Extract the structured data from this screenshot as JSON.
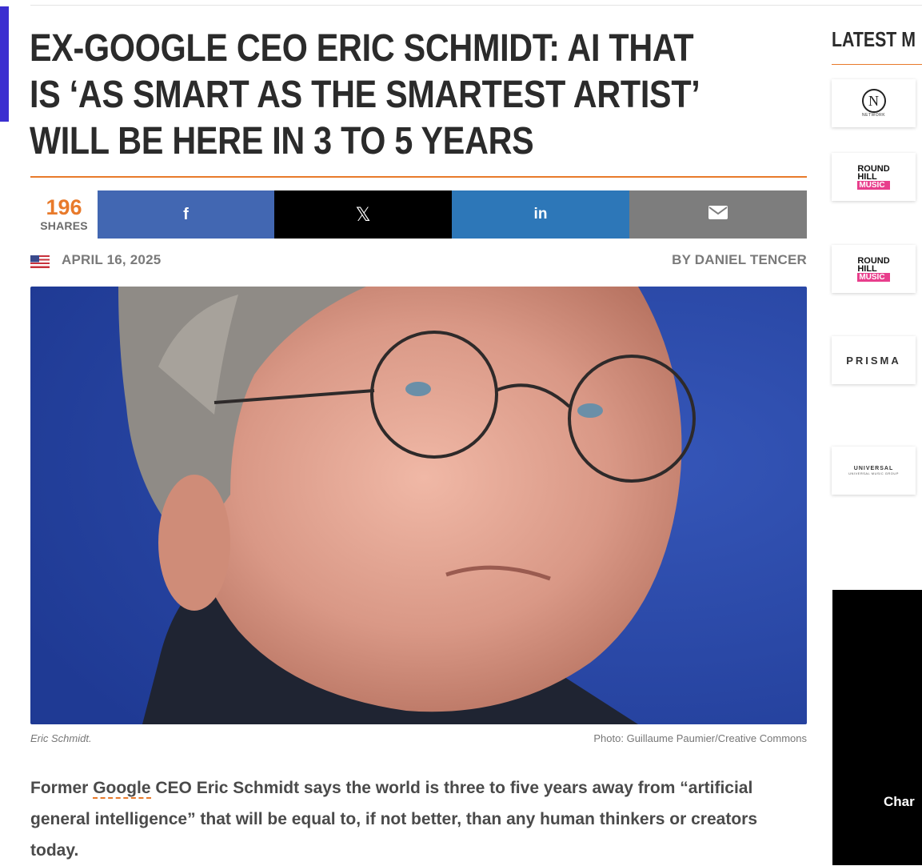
{
  "article": {
    "headline": "EX-GOOGLE CEO ERIC SCHMIDT: AI THAT IS ‘AS SMART AS THE SMARTEST ARTIST’ WILL BE HERE IN 3 TO 5 YEARS",
    "shares": {
      "count": "196",
      "label": "SHARES"
    },
    "share_buttons": [
      {
        "network": "facebook",
        "glyph": "f",
        "icon": "facebook-icon",
        "color": "#4267b2"
      },
      {
        "network": "x",
        "glyph": "𝕏",
        "icon": "x-icon",
        "color": "#000000"
      },
      {
        "network": "linkedin",
        "glyph": "in",
        "icon": "linkedin-icon",
        "color": "#2d77b8"
      },
      {
        "network": "email",
        "glyph": "",
        "icon": "envelope-icon",
        "color": "#7d7d7d"
      }
    ],
    "date": "APRIL 16, 2025",
    "byline": "BY DANIEL TENCER",
    "photo_caption": "Eric Schmidt.",
    "photo_credit": "Photo: Guillaume Paumier/Creative Commons",
    "lead": {
      "before_link": "Former ",
      "link_text": "Google",
      "after_link": " CEO Eric Schmidt says the world is three to five years away from “artificial general intelligence” that will be equal to, if not better, than any human thinkers or creators today."
    }
  },
  "sidebar": {
    "title": "LATEST M",
    "logos": [
      {
        "name": "N NETWORK",
        "text": "N",
        "sub": "NETWORK"
      },
      {
        "name": "ROUND HILL MUSIC",
        "line1": "ROUND",
        "line2": "HILL",
        "line3": "MUSIC"
      },
      {
        "name": "ROUND HILL MUSIC",
        "line1": "ROUND",
        "line2": "HILL",
        "line3": "MUSIC"
      },
      {
        "name": "PRISMA",
        "text": "PRISMA"
      },
      {
        "name": "UNIVERSAL MUSIC GROUP",
        "text": "UNIVERSAL",
        "sub": "UNIVERSAL MUSIC GROUP"
      }
    ],
    "video_text": "Char"
  },
  "colors": {
    "accent": "#e87a2b",
    "left_accent": "#3b2fd0",
    "photo_background": "#2a48a8",
    "roundhill_pink": "#e83e8c"
  }
}
